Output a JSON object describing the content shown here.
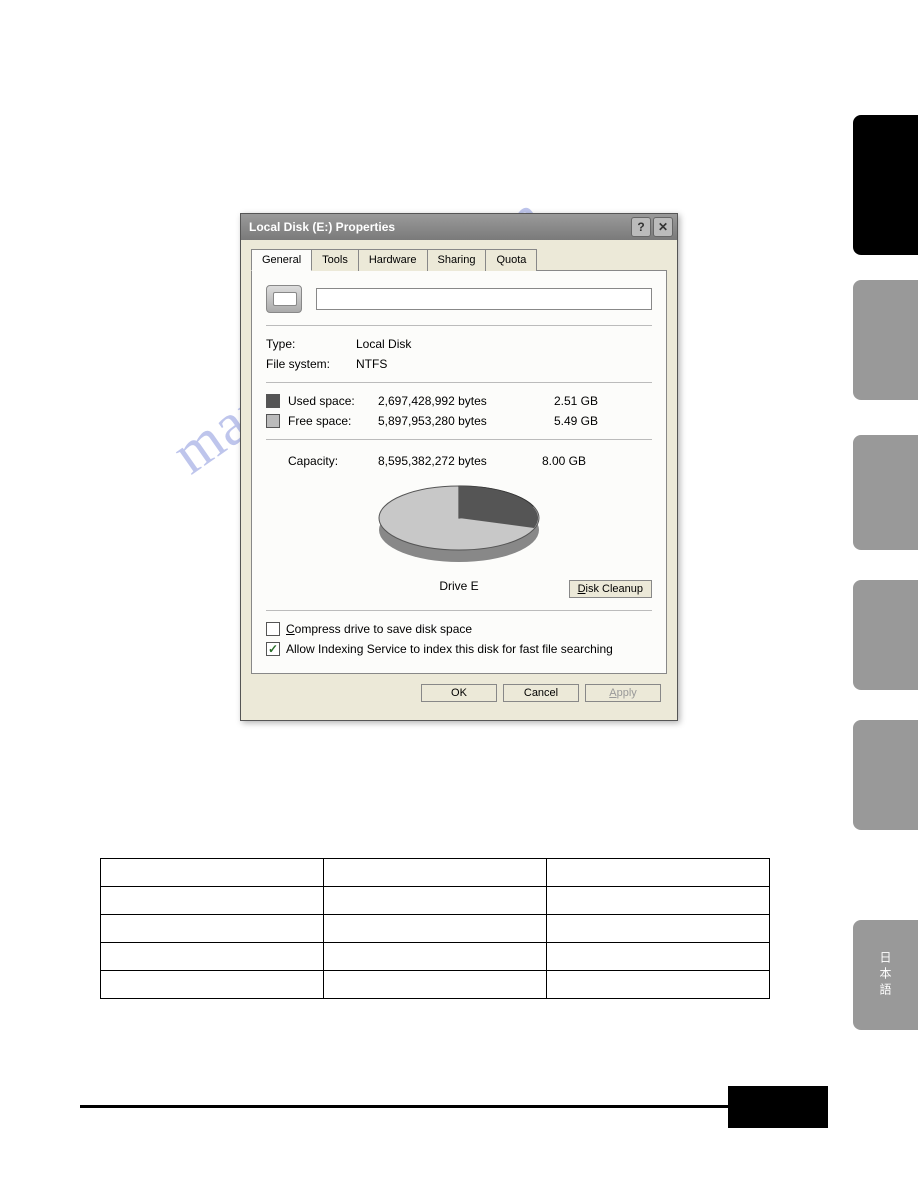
{
  "watermark": "manualshive.com",
  "dialog": {
    "title": "Local Disk (E:) Properties",
    "tabs": [
      "General",
      "Tools",
      "Hardware",
      "Sharing",
      "Quota"
    ],
    "active_tab": 0,
    "name_value": "",
    "type_label": "Type:",
    "type_value": "Local Disk",
    "fs_label": "File system:",
    "fs_value": "NTFS",
    "used_label": "Used space:",
    "used_bytes": "2,697,428,992 bytes",
    "used_gb": "2.51 GB",
    "free_label": "Free space:",
    "free_bytes": "5,897,953,280 bytes",
    "free_gb": "5.49 GB",
    "capacity_label": "Capacity:",
    "capacity_bytes": "8,595,382,272 bytes",
    "capacity_gb": "8.00 GB",
    "drive_label": "Drive E",
    "cleanup_label": "Disk Cleanup",
    "compress_label": "Compress drive to save disk space",
    "compress_checked": false,
    "index_label": "Allow Indexing Service to index this disk for fast file searching",
    "index_checked": true,
    "ok_label": "OK",
    "cancel_label": "Cancel",
    "apply_label": "Apply"
  },
  "chart_data": {
    "type": "pie",
    "title": "Drive E",
    "series": [
      {
        "name": "Used space",
        "value": 2697428992,
        "value_gb": 2.51
      },
      {
        "name": "Free space",
        "value": 5897953280,
        "value_gb": 5.49
      }
    ],
    "total": 8595382272,
    "total_gb": 8.0
  },
  "side_jp_label": "日本語"
}
